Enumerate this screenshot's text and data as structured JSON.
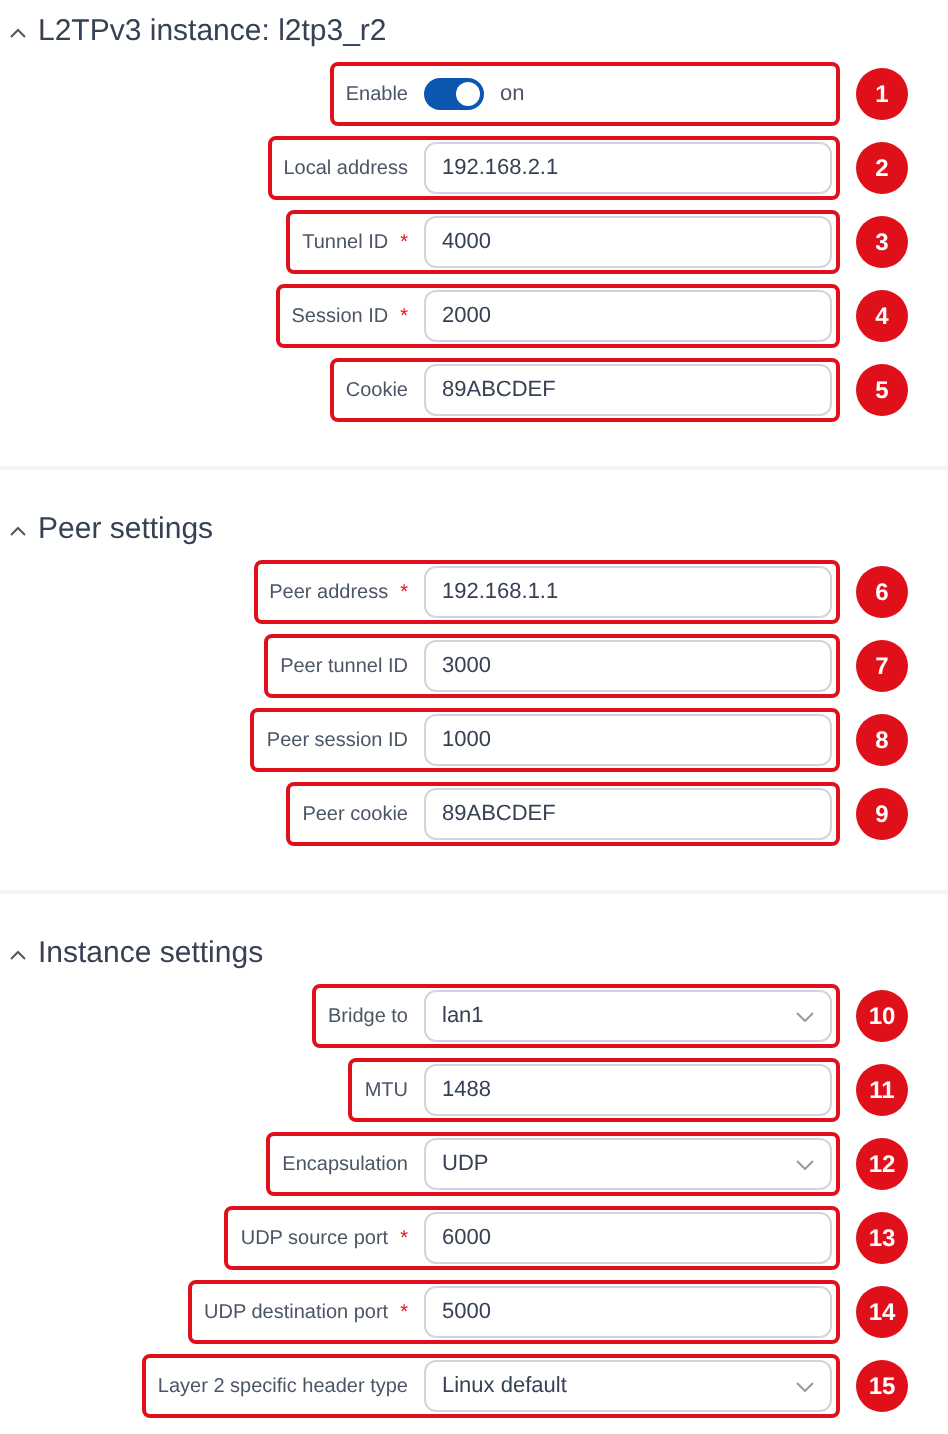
{
  "sections": [
    {
      "title": "L2TPv3 instance: l2tp3_r2",
      "expanded": true,
      "fields": [
        {
          "kind": "toggle",
          "label": "Enable",
          "on": true,
          "value": "on",
          "badge": "1"
        },
        {
          "kind": "text",
          "label": "Local address",
          "value": "192.168.2.1",
          "badge": "2"
        },
        {
          "kind": "text",
          "label": "Tunnel ID",
          "required_mark": "*",
          "value": "4000",
          "badge": "3"
        },
        {
          "kind": "text",
          "label": "Session ID",
          "required_mark": "*",
          "value": "2000",
          "badge": "4"
        },
        {
          "kind": "text",
          "label": "Cookie",
          "value": "89ABCDEF",
          "badge": "5"
        }
      ]
    },
    {
      "title": "Peer settings",
      "expanded": true,
      "fields": [
        {
          "kind": "text",
          "label": "Peer address",
          "required_mark": "*",
          "value": "192.168.1.1",
          "badge": "6"
        },
        {
          "kind": "text",
          "label": "Peer tunnel ID",
          "value": "3000",
          "badge": "7"
        },
        {
          "kind": "text",
          "label": "Peer session ID",
          "value": "1000",
          "badge": "8"
        },
        {
          "kind": "text",
          "label": "Peer cookie",
          "value": "89ABCDEF",
          "badge": "9"
        }
      ]
    },
    {
      "title": "Instance settings",
      "expanded": true,
      "fields": [
        {
          "kind": "select",
          "label": "Bridge to",
          "value": "lan1",
          "badge": "10"
        },
        {
          "kind": "text",
          "label": "MTU",
          "value": "1488",
          "badge": "11"
        },
        {
          "kind": "select",
          "label": "Encapsulation",
          "value": "UDP",
          "badge": "12"
        },
        {
          "kind": "text",
          "label": "UDP source port",
          "required_mark": "*",
          "value": "6000",
          "badge": "13"
        },
        {
          "kind": "text",
          "label": "UDP destination port",
          "required_mark": "*",
          "value": "5000",
          "badge": "14"
        },
        {
          "kind": "select",
          "label": "Layer 2 specific header type",
          "value": "Linux default",
          "badge": "15"
        }
      ]
    }
  ]
}
